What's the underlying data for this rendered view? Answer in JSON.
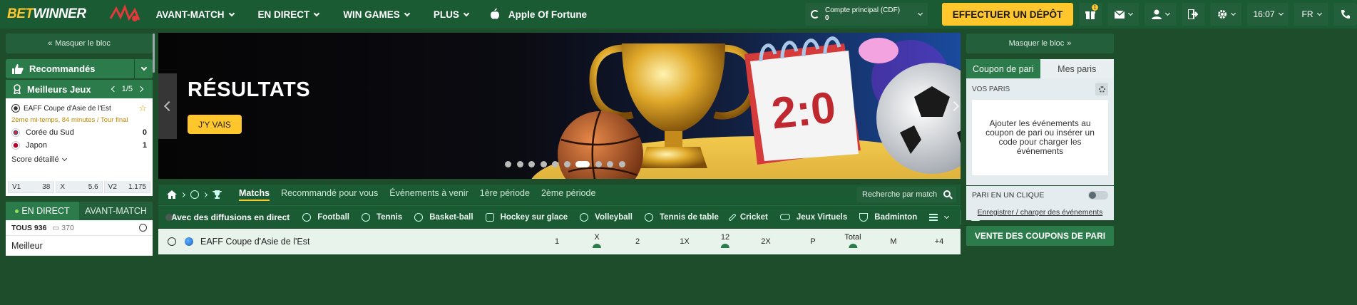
{
  "header": {
    "logo_prefix": "BET",
    "logo_suffix": "WINNER",
    "nav": [
      {
        "label": "AVANT-MATCH"
      },
      {
        "label": "EN DIRECT"
      },
      {
        "label": "WIN GAMES"
      },
      {
        "label": "PLUS"
      }
    ],
    "featured_game": "Apple Of Fortune",
    "account_label": "Compte principal (CDF)",
    "account_balance": "0",
    "deposit_label": "EFFECTUER UN DÉPÔT",
    "gift_badge": "1",
    "time": "16:07",
    "language": "FR"
  },
  "left": {
    "hide_label": "Masquer le bloc",
    "recommended_label": "Recommandés",
    "best_games_label": "Meilleurs Jeux",
    "pager": "1/5",
    "match": {
      "league": "EAFF Coupe d'Asie de l'Est",
      "period": "2ème mi-temps, 84 minutes / Tour final",
      "team1": "Corée du Sud",
      "score1": "0",
      "team2": "Japon",
      "score2": "1",
      "detail_label": "Score détaillé",
      "odds": [
        {
          "label": "V1",
          "value": "38"
        },
        {
          "label": "X",
          "value": "5.6"
        },
        {
          "label": "V2",
          "value": "1.175"
        }
      ]
    },
    "live_tab": "EN DIRECT",
    "prematch_tab": "AVANT-MATCH",
    "all_label": "TOUS 936",
    "all_count": "370",
    "best_row": "Meilleur"
  },
  "banner": {
    "title": "RÉSULTATS",
    "button": "J'Y VAIS",
    "calendar_score": "2:0",
    "slide_count": 10,
    "active_slide": 6
  },
  "filters": {
    "tabs": [
      "Matchs",
      "Recommandé pour vous",
      "Événements à venir",
      "1ère période",
      "2ème période"
    ],
    "search_placeholder": "Recherche par match"
  },
  "sportbar": {
    "toggle_label": "Avec des diffusions en direct",
    "sports": [
      "Football",
      "Tennis",
      "Basket-ball",
      "Hockey sur glace",
      "Volleyball",
      "Tennis de table",
      "Cricket",
      "Jeux Virtuels",
      "Badminton"
    ]
  },
  "table": {
    "league": "EAFF Coupe d'Asie de l'Est",
    "columns": [
      "1",
      "X",
      "2",
      "1X",
      "12",
      "2X",
      "P",
      "Total",
      "M",
      "+4"
    ]
  },
  "right": {
    "hide_label": "Masquer le bloc",
    "tab_coupon": "Coupon de pari",
    "tab_mybets": "Mes paris",
    "vos_paris": "VOS PARIS",
    "empty_text": "Ajouter les événements au coupon de pari ou insérer un code pour charger les événements",
    "one_click": "PARI EN UN CLIQUE",
    "register": "Enregistrer / charger des événements",
    "sale": "VENTE DES COUPONS DE PARI"
  },
  "colors": {
    "brand_green": "#1a5b34",
    "accent_yellow": "#ffc72c"
  }
}
